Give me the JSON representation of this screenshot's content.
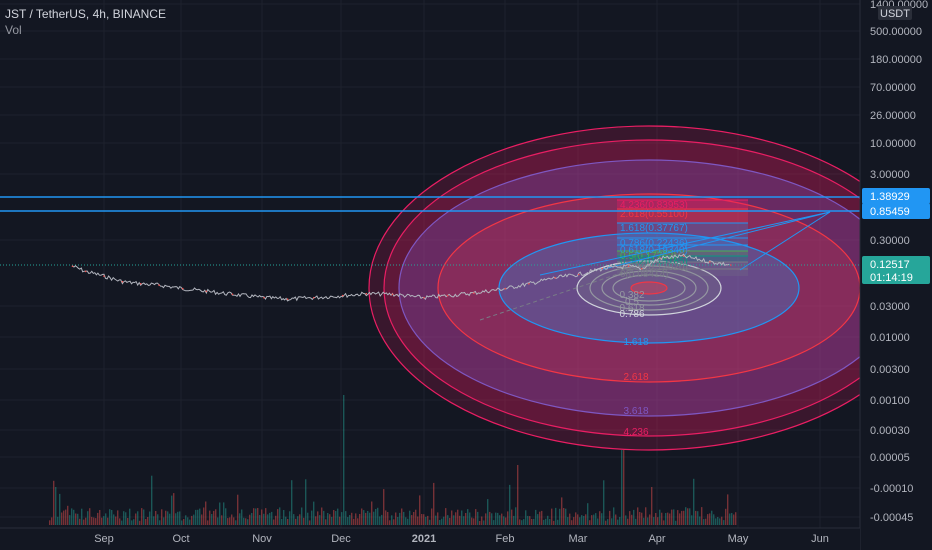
{
  "header": {
    "symbol_line": "JST / TetherUS, 4h, BINANCE",
    "volume_label": "Vol"
  },
  "price_axis": {
    "currency": "USDT",
    "ticks": [
      "1400.00000",
      "500.00000",
      "180.00000",
      "70.00000",
      "26.00000",
      "10.00000",
      "3.00000",
      "0.30000",
      "0.03000",
      "0.01000",
      "0.00300",
      "0.00100",
      "0.00030",
      "0.00005",
      "-0.00010",
      "-0.00045"
    ],
    "highlight_labels": [
      {
        "text": "1.38929",
        "color": "#2196f3"
      },
      {
        "text": "0.85459",
        "color": "#2196f3"
      },
      {
        "text": "0.12517",
        "sub": "01:14:19",
        "color": "#26a69a"
      }
    ]
  },
  "time_axis": {
    "labels": [
      "Sep",
      "Oct",
      "Nov",
      "Dec",
      "2021",
      "Feb",
      "Mar",
      "Apr",
      "May",
      "Jun"
    ],
    "bold": [
      "2021"
    ]
  },
  "fib_levels_top": [
    {
      "text": "4.236(0.83953)",
      "color": "#e91e63"
    },
    {
      "text": "2.618(0.55100)",
      "color": "#f23645"
    },
    {
      "text": "1.618(0.37767)",
      "color": "#2196f3"
    },
    {
      "text": "0.786(0.22436)",
      "color": "#2196f3"
    },
    {
      "text": "0.618(0.19340)",
      "color": "#2196f3"
    },
    {
      "text": "0.5(0.17262)",
      "color": "#4caf50"
    },
    {
      "text": "0.382(0.15185)",
      "color": "#089981"
    },
    {
      "text": "0.236(0.12620)",
      "color": "#787b86"
    },
    {
      "text": "0(0.08414)",
      "color": "#787b86"
    }
  ],
  "fib_circle_labels": [
    {
      "text": "0.382",
      "color": "#9598a1"
    },
    {
      "text": "0.5",
      "color": "#9598a1"
    },
    {
      "text": "0.618",
      "color": "#9598a1"
    },
    {
      "text": "0.786",
      "color": "#d1d4dc"
    },
    {
      "text": "1.618",
      "color": "#2196f3"
    },
    {
      "text": "2.618",
      "color": "#f23645"
    },
    {
      "text": "3.618",
      "color": "#7e57c2"
    },
    {
      "text": "4.236",
      "color": "#e91e63"
    }
  ],
  "chart_data": {
    "type": "line",
    "title": "JST / TetherUS, 4h, BINANCE",
    "y_scale": "log",
    "price_series": [
      {
        "x": "2020-08-20",
        "y": 0.12
      },
      {
        "x": "2020-08-25",
        "y": 0.1
      },
      {
        "x": "2020-09-01",
        "y": 0.085
      },
      {
        "x": "2020-09-08",
        "y": 0.07
      },
      {
        "x": "2020-09-15",
        "y": 0.065
      },
      {
        "x": "2020-09-22",
        "y": 0.062
      },
      {
        "x": "2020-10-01",
        "y": 0.055
      },
      {
        "x": "2020-10-10",
        "y": 0.05
      },
      {
        "x": "2020-10-20",
        "y": 0.045
      },
      {
        "x": "2020-11-01",
        "y": 0.04
      },
      {
        "x": "2020-11-10",
        "y": 0.038
      },
      {
        "x": "2020-11-20",
        "y": 0.04
      },
      {
        "x": "2020-12-01",
        "y": 0.043
      },
      {
        "x": "2020-12-10",
        "y": 0.046
      },
      {
        "x": "2020-12-20",
        "y": 0.045
      },
      {
        "x": "2021-01-01",
        "y": 0.04
      },
      {
        "x": "2021-01-10",
        "y": 0.043
      },
      {
        "x": "2021-01-20",
        "y": 0.047
      },
      {
        "x": "2021-02-01",
        "y": 0.055
      },
      {
        "x": "2021-02-10",
        "y": 0.065
      },
      {
        "x": "2021-02-20",
        "y": 0.08
      },
      {
        "x": "2021-03-01",
        "y": 0.09
      },
      {
        "x": "2021-03-10",
        "y": 0.11
      },
      {
        "x": "2021-03-20",
        "y": 0.12
      },
      {
        "x": "2021-03-25",
        "y": 0.11
      },
      {
        "x": "2021-04-01",
        "y": 0.16
      },
      {
        "x": "2021-04-10",
        "y": 0.17
      },
      {
        "x": "2021-04-20",
        "y": 0.14
      },
      {
        "x": "2021-04-28",
        "y": 0.12517
      }
    ],
    "horizontal_lines": [
      1.38929,
      0.85459
    ],
    "last_price": 0.12517
  }
}
